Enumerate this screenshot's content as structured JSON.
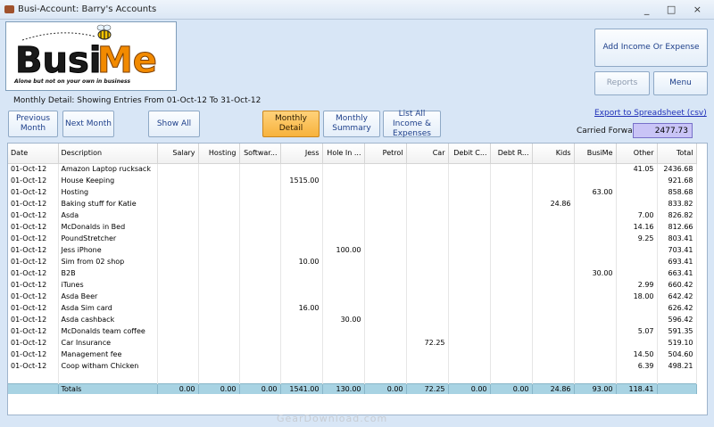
{
  "window": {
    "title": "Busi-Account: Barry's Accounts",
    "controls": "_ □ ×"
  },
  "logo": {
    "brand": "BusiMe",
    "tagline": "Alone but not on your own in business"
  },
  "buttons": {
    "add_income": "Add Income Or Expense",
    "reports": "Reports",
    "menu": "Menu",
    "previous_month": "Previous Month",
    "next_month": "Next Month",
    "show_all": "Show All",
    "monthly_detail": "Monthly Detail",
    "monthly_summary": "Monthly Summary",
    "list_all": "List All Income & Expenses"
  },
  "detail_label": "Monthly Detail: Showing Entries From 01-Oct-12 To 31-Oct-12",
  "export_link": "Export to Spreadsheet (csv)",
  "carried_forward": {
    "label": "Carried Forward",
    "value": "2477.73"
  },
  "table": {
    "columns": [
      "Date",
      "Description",
      "Salary",
      "Hosting",
      "Softwar...",
      "Jess",
      "Hole In ...",
      "Petrol",
      "Car",
      "Debit C...",
      "Debt R...",
      "Kids",
      "BusiMe",
      "Other",
      "Total"
    ],
    "rows": [
      [
        "01-Oct-12",
        "Amazon Laptop rucksack",
        "",
        "",
        "",
        "",
        "",
        "",
        "",
        "",
        "",
        "",
        "",
        "41.05",
        "2436.68"
      ],
      [
        "01-Oct-12",
        "House Keeping",
        "",
        "",
        "",
        "1515.00",
        "",
        "",
        "",
        "",
        "",
        "",
        "",
        "",
        "921.68"
      ],
      [
        "01-Oct-12",
        "Hosting",
        "",
        "",
        "",
        "",
        "",
        "",
        "",
        "",
        "",
        "",
        "63.00",
        "",
        "858.68"
      ],
      [
        "01-Oct-12",
        "Baking stuff for Katie",
        "",
        "",
        "",
        "",
        "",
        "",
        "",
        "",
        "",
        "24.86",
        "",
        "",
        "833.82"
      ],
      [
        "01-Oct-12",
        "Asda",
        "",
        "",
        "",
        "",
        "",
        "",
        "",
        "",
        "",
        "",
        "",
        "7.00",
        "826.82"
      ],
      [
        "01-Oct-12",
        "McDonalds in Bed",
        "",
        "",
        "",
        "",
        "",
        "",
        "",
        "",
        "",
        "",
        "",
        "14.16",
        "812.66"
      ],
      [
        "01-Oct-12",
        "PoundStretcher",
        "",
        "",
        "",
        "",
        "",
        "",
        "",
        "",
        "",
        "",
        "",
        "9.25",
        "803.41"
      ],
      [
        "01-Oct-12",
        "Jess iPhone",
        "",
        "",
        "",
        "",
        "100.00",
        "",
        "",
        "",
        "",
        "",
        "",
        "",
        "703.41"
      ],
      [
        "01-Oct-12",
        "Sim from 02 shop",
        "",
        "",
        "",
        "10.00",
        "",
        "",
        "",
        "",
        "",
        "",
        "",
        "",
        "693.41"
      ],
      [
        "01-Oct-12",
        "B2B",
        "",
        "",
        "",
        "",
        "",
        "",
        "",
        "",
        "",
        "",
        "30.00",
        "",
        "663.41"
      ],
      [
        "01-Oct-12",
        "iTunes",
        "",
        "",
        "",
        "",
        "",
        "",
        "",
        "",
        "",
        "",
        "",
        "2.99",
        "660.42"
      ],
      [
        "01-Oct-12",
        "Asda Beer",
        "",
        "",
        "",
        "",
        "",
        "",
        "",
        "",
        "",
        "",
        "",
        "18.00",
        "642.42"
      ],
      [
        "01-Oct-12",
        "Asda Sim card",
        "",
        "",
        "",
        "16.00",
        "",
        "",
        "",
        "",
        "",
        "",
        "",
        "",
        "626.42"
      ],
      [
        "01-Oct-12",
        "Asda cashback",
        "",
        "",
        "",
        "",
        "30.00",
        "",
        "",
        "",
        "",
        "",
        "",
        "",
        "596.42"
      ],
      [
        "01-Oct-12",
        "McDonalds team coffee",
        "",
        "",
        "",
        "",
        "",
        "",
        "",
        "",
        "",
        "",
        "",
        "5.07",
        "591.35"
      ],
      [
        "01-Oct-12",
        "Car Insurance",
        "",
        "",
        "",
        "",
        "",
        "",
        "72.25",
        "",
        "",
        "",
        "",
        "",
        "519.10"
      ],
      [
        "01-Oct-12",
        "Management fee",
        "",
        "",
        "",
        "",
        "",
        "",
        "",
        "",
        "",
        "",
        "",
        "14.50",
        "504.60"
      ],
      [
        "01-Oct-12",
        "Coop witham Chicken",
        "",
        "",
        "",
        "",
        "",
        "",
        "",
        "",
        "",
        "",
        "",
        "6.39",
        "498.21"
      ]
    ],
    "totals": [
      "",
      "Totals",
      "0.00",
      "0.00",
      "0.00",
      "1541.00",
      "130.00",
      "0.00",
      "72.25",
      "0.00",
      "0.00",
      "24.86",
      "93.00",
      "118.41",
      ""
    ]
  },
  "watermark": "GearDownload.com",
  "colors": {
    "window_bg": "#d8e6f6",
    "active_tab": "#f7b23c",
    "carried_forward_bg": "#c9c4f6",
    "totals_row": "#a8d3e3",
    "link": "#1f2fb8"
  }
}
